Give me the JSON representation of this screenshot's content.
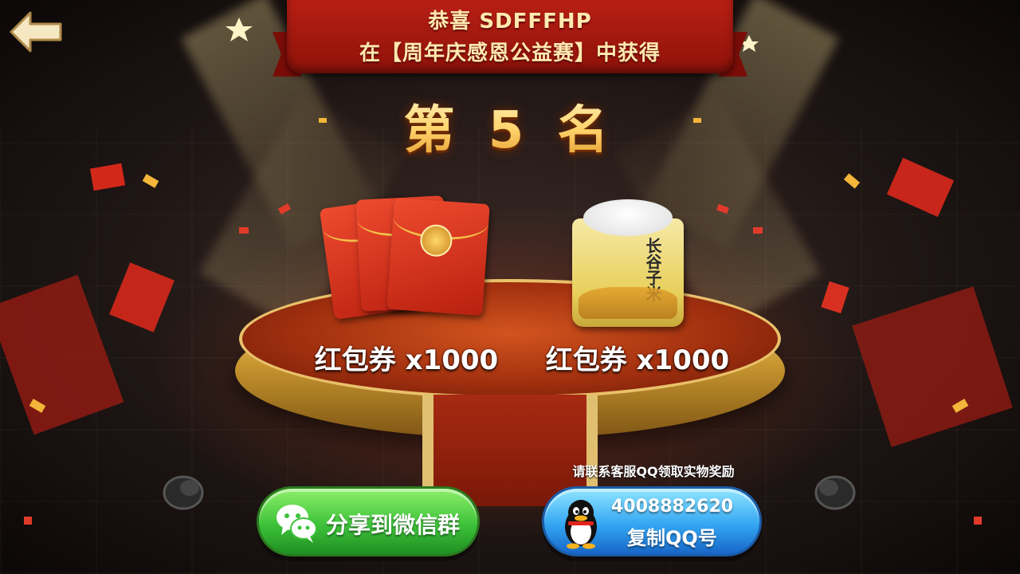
{
  "header": {
    "congrats_text": "恭喜 SDFFFHP",
    "event_text": "在【周年庆感恩公益赛】中获得",
    "rank_text": "第 5 名"
  },
  "prizes": [
    {
      "icon": "red-envelope-icon",
      "label": "红包券 x1000"
    },
    {
      "icon": "rice-bag-icon",
      "brand": "长谷子米",
      "label": "红包券 x1000"
    }
  ],
  "actions": {
    "share_label": "分享到微信群",
    "qq_hint": "请联系客服QQ领取实物奖励",
    "qq_number": "4008882620",
    "qq_copy_label": "复制QQ号"
  },
  "colors": {
    "ribbon": "#b81f14",
    "gold": "#ffd36a",
    "share_button": "#3ec23a",
    "qq_button": "#34a6f2"
  }
}
